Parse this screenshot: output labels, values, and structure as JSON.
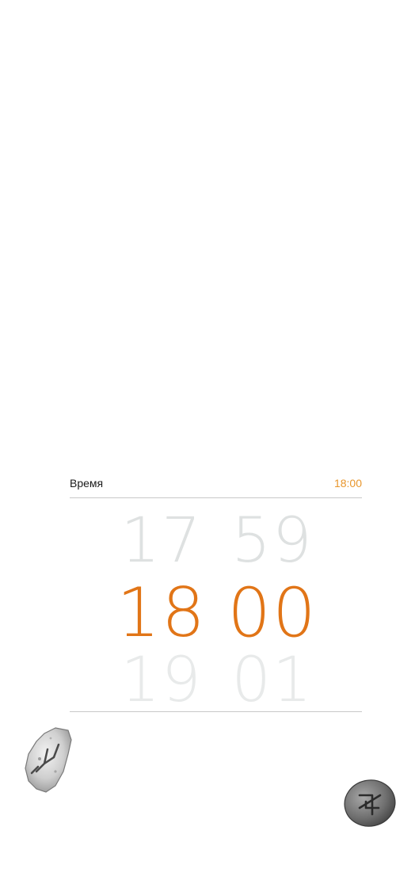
{
  "time_row": {
    "label": "Время",
    "value": "18:00"
  },
  "picker": {
    "hours": {
      "prev": "17",
      "current": "18",
      "next": "19"
    },
    "minutes": {
      "prev": "59",
      "current": "00",
      "next": "01"
    }
  },
  "colors": {
    "accent": "#e17517",
    "value_text": "#e8962c",
    "faded_numbers": "#dcdfdf"
  },
  "icons": {
    "left_rune": "rune-stone-icon",
    "right_rune": "rune-stone-icon"
  }
}
